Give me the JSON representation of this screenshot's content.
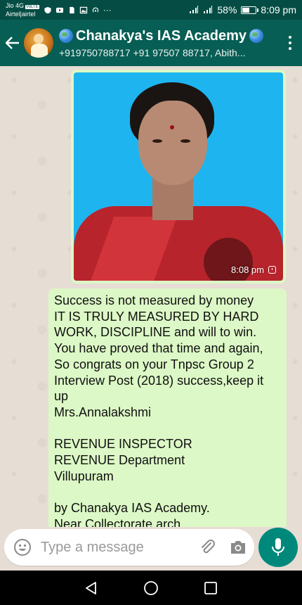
{
  "status_bar": {
    "carrier_1": "Jio 4G",
    "carrier_2": "Airtel|airtel",
    "volte_badge": "VoLTE",
    "overflow": "···",
    "battery_percent": "58%",
    "battery_level": 0.58,
    "time": "8:09 pm"
  },
  "header": {
    "title": "Chanakya's IAS Academy",
    "subtitle": "+919750788717 +91 97507 88717, Abith..."
  },
  "photo_message": {
    "time": "8:08 pm"
  },
  "text_message": {
    "body": "Success is not measured by money\nIT IS TRULY MEASURED BY HARD WORK, DISCIPLINE and will to win. You have proved that time and again, So congrats on your Tnpsc Group 2 Interview Post (2018) success,keep it up\nMrs.Annalakshmi\n\nREVENUE INSPECTOR\nREVENUE Department\nVillupuram\n\nby Chanakya IAS Academy.\nNear Collectorate arch"
  },
  "input": {
    "placeholder": "Type a message"
  },
  "colors": {
    "header": "#075e54",
    "status_bar": "#054d44",
    "outgoing_bubble": "#dcf8c6",
    "mic_button": "#00897b"
  },
  "icons": {
    "back": "arrow-left-icon",
    "menu": "more-vert-icon",
    "emoji": "emoji-icon",
    "attach": "paperclip-icon",
    "camera": "camera-icon",
    "mic": "mic-icon",
    "nav_back": "triangle-back-icon",
    "nav_home": "circle-home-icon",
    "nav_recents": "square-recents-icon"
  }
}
